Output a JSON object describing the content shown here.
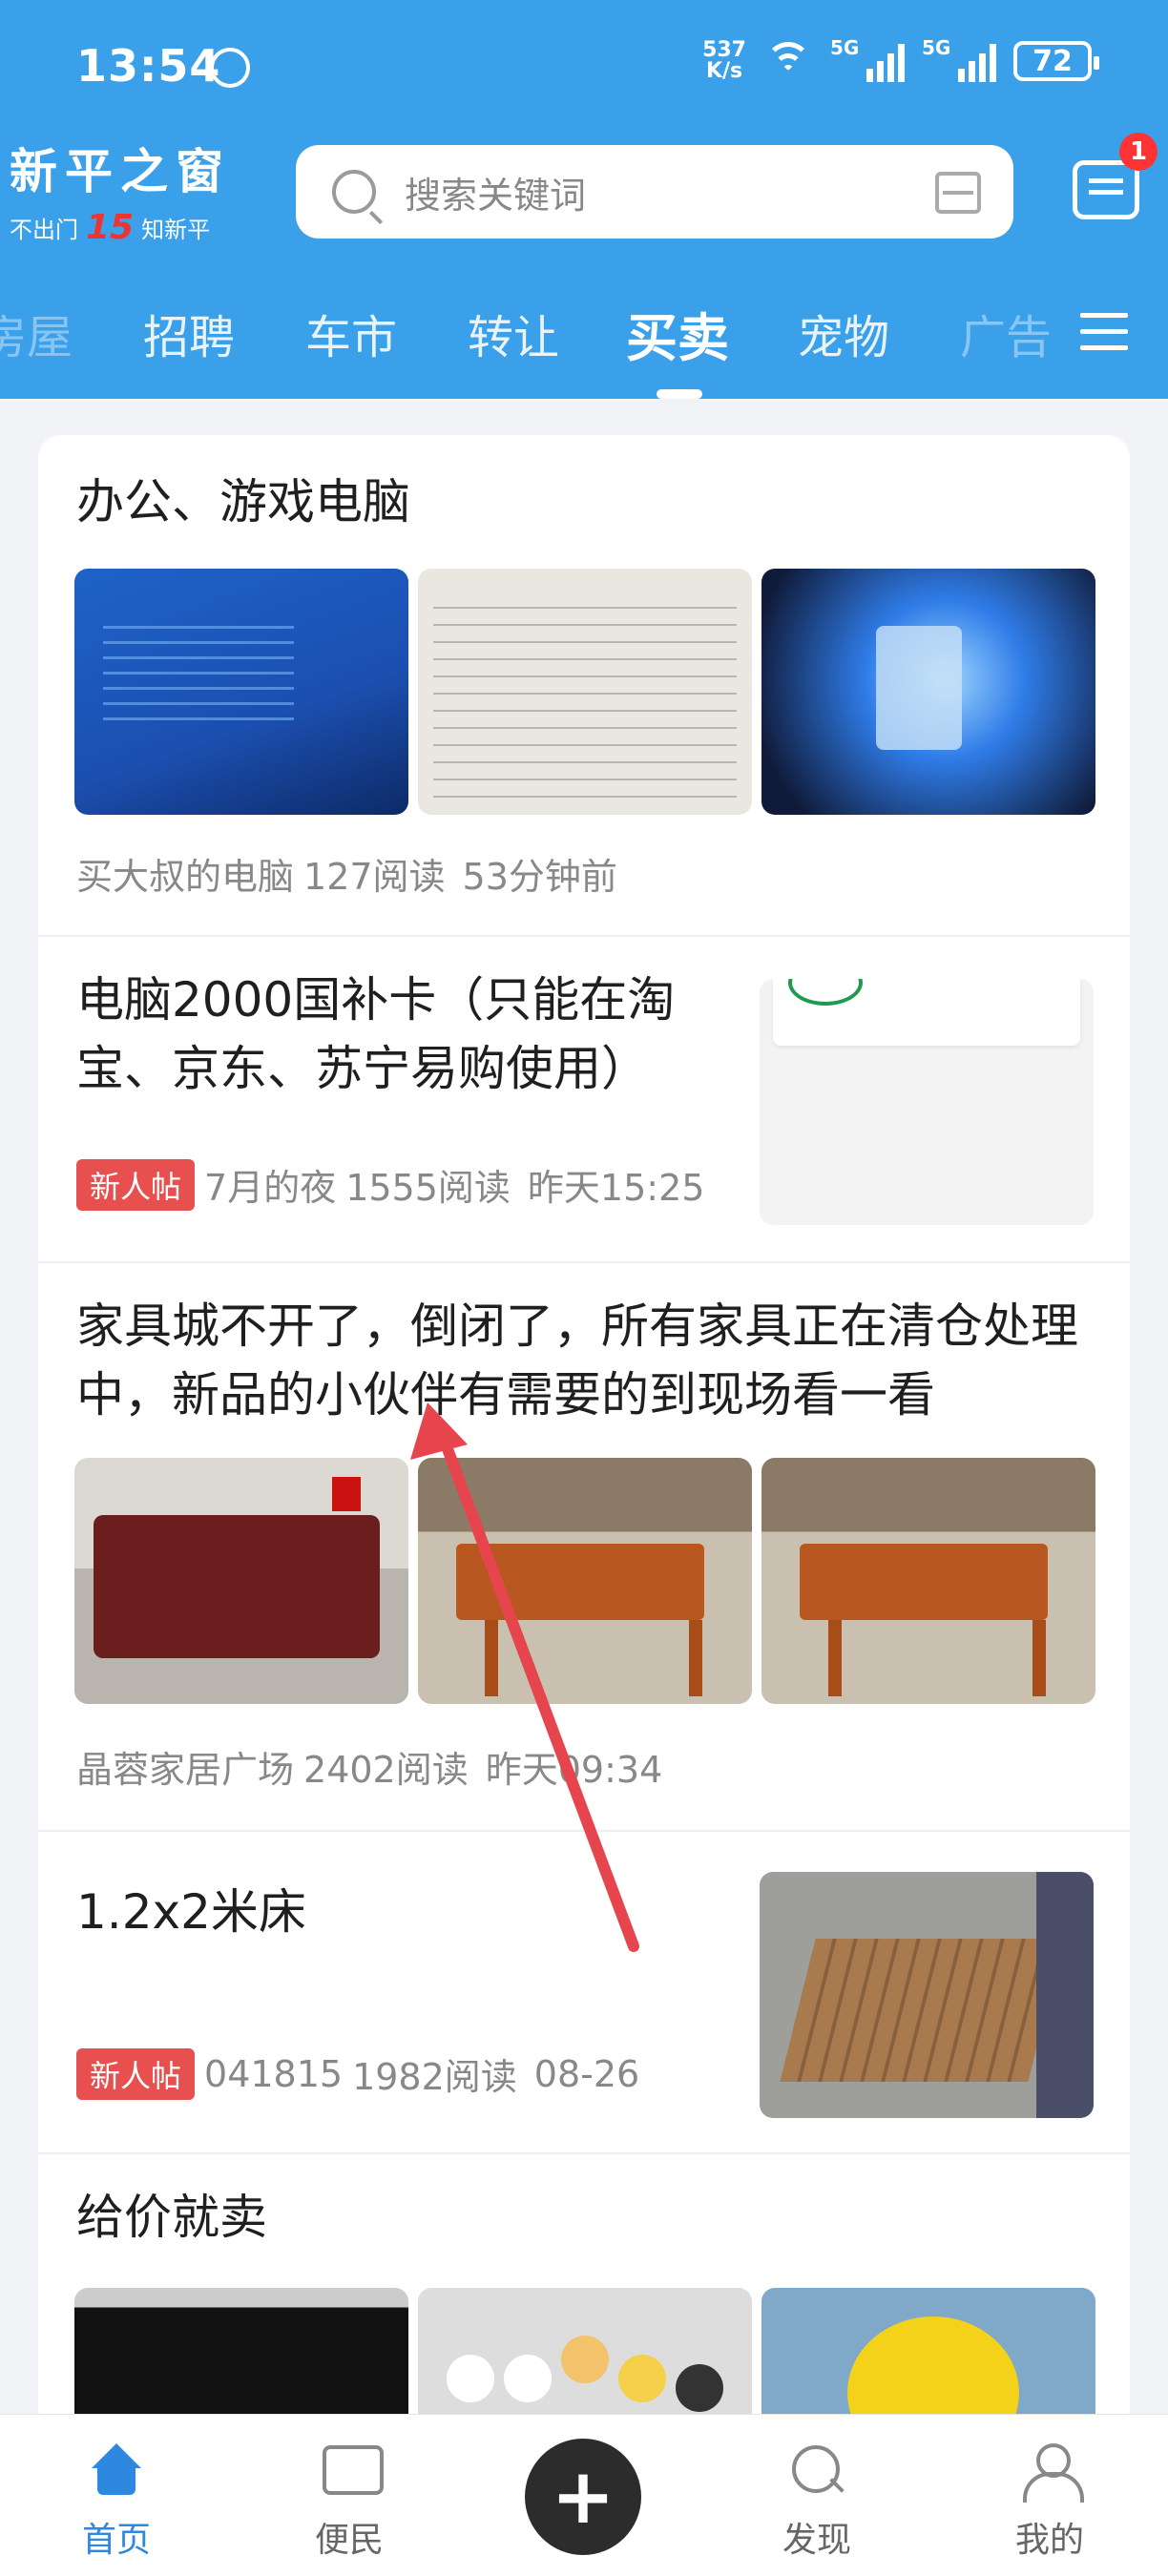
{
  "status_bar": {
    "time": "13:54",
    "net_speed_value": "537",
    "net_speed_unit": "K/s",
    "sim1": "5G",
    "sim2": "5G",
    "battery": "72"
  },
  "header": {
    "logo_name": "新平之窗",
    "slogan_left": "不出门",
    "slogan_mid": "15",
    "slogan_right": "知新平",
    "search_placeholder": "搜索关键词",
    "message_badge": "1",
    "accent": "#3aa0ea"
  },
  "tabs": [
    {
      "label": "房屋",
      "active": false
    },
    {
      "label": "招聘",
      "active": false
    },
    {
      "label": "车市",
      "active": false
    },
    {
      "label": "转让",
      "active": false
    },
    {
      "label": "买卖",
      "active": true
    },
    {
      "label": "宠物",
      "active": false
    },
    {
      "label": "广告",
      "active": false
    }
  ],
  "posts": [
    {
      "title": "办公、游戏电脑",
      "author": "买大叔的电脑",
      "reads": "127阅读",
      "time": "53分钟前",
      "new_tag": ""
    },
    {
      "title": "电脑2000国补卡（只能在淘宝、京东、苏宁易购使用）",
      "author": "7月的夜",
      "reads": "1555阅读",
      "time": "昨天15:25",
      "new_tag": "新人帖"
    },
    {
      "title": "家具城不开了，倒闭了，所有家具正在清仓处理中，新品的小伙伴有需要的到现场看一看",
      "author": "晶蓉家居广场",
      "reads": "2402阅读",
      "time": "昨天09:34",
      "new_tag": ""
    },
    {
      "title": "1.2x2米床",
      "author": "041815",
      "reads": "1982阅读",
      "time": "08-26",
      "new_tag": "新人帖"
    },
    {
      "title": "给价就卖",
      "author": "",
      "reads": "",
      "time": "",
      "new_tag": ""
    }
  ],
  "bottom_nav": [
    {
      "label": "首页",
      "icon": "home-icon",
      "active": true
    },
    {
      "label": "便民",
      "icon": "chat-icon",
      "active": false
    },
    {
      "label": "",
      "icon": "plus-icon",
      "active": false
    },
    {
      "label": "发现",
      "icon": "search-icon",
      "active": false
    },
    {
      "label": "我的",
      "icon": "user-icon",
      "active": false
    }
  ],
  "plus_symbol": "+"
}
